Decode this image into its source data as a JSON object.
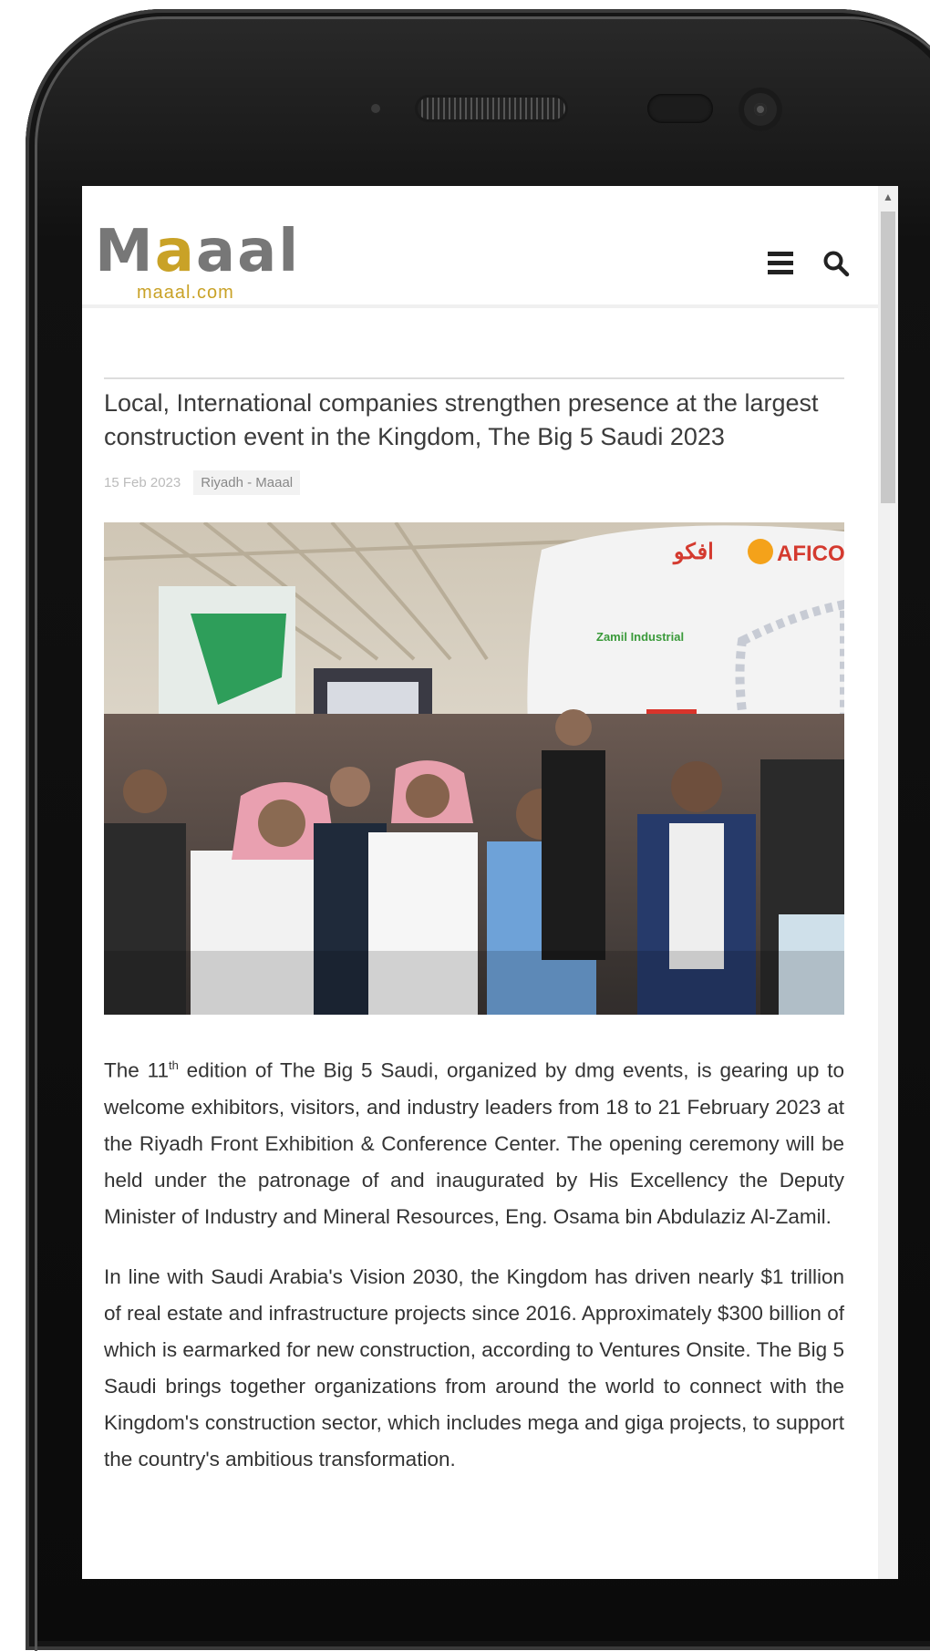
{
  "site": {
    "logo_text": "Maaal",
    "logo_url": "maaal.com"
  },
  "article": {
    "title": "Local, International companies strengthen presence at the largest construction event in the Kingdom, The Big 5 Saudi 2023",
    "date": "15 Feb 2023",
    "source": "Riyadh - Maaal",
    "image_signs": {
      "aficco": "AFICO",
      "aficco_ar": "افكو",
      "zamil": "Zamil Industrial"
    },
    "paragraph1_pre": "The 11",
    "paragraph1_sup": "th",
    "paragraph1_post": " edition of The Big 5 Saudi, organized by dmg events, is gearing up to welcome exhibitors, visitors, and industry leaders from 18 to 21 February 2023 at the Riyadh Front Exhibition & Conference Center. The opening ceremony will be held under the patronage of and inaugurated by His Excellency the Deputy Minister of Industry and Mineral Resources, Eng. Osama bin Abdulaziz Al-Zamil.",
    "paragraph2": "In line with Saudi Arabia's Vision 2030, the Kingdom has driven nearly $1 trillion of real estate and infrastructure projects since 2016. Approximately $300 billion of which is earmarked for new construction, according to Ventures Onsite. The Big 5 Saudi brings together organizations from around the world to connect with the Kingdom's construction sector, which includes mega and giga projects, to support the country's ambitious transformation."
  },
  "icons": {
    "menu": "hamburger-menu-icon",
    "search": "search-icon",
    "scroll_up": "chevron-up-icon"
  },
  "colors": {
    "brand_gold": "#c9a227",
    "brand_gray": "#777777"
  }
}
